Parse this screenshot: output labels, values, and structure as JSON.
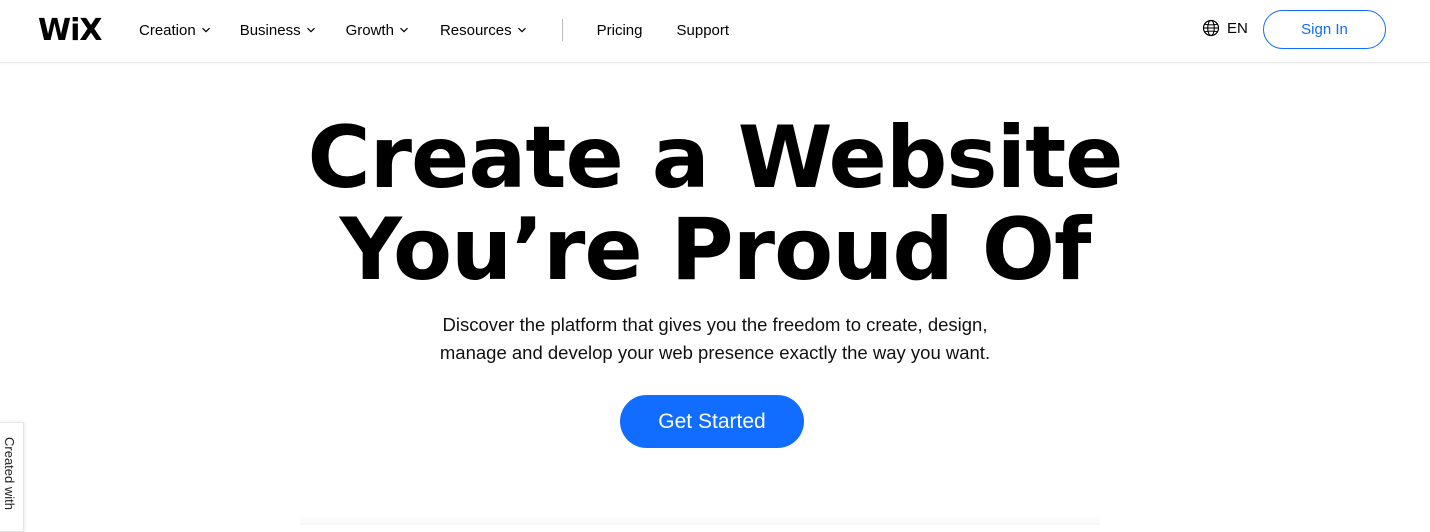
{
  "brand": {
    "logo_text": "WiX"
  },
  "nav": {
    "items": [
      {
        "label": "Creation",
        "has_dropdown": true
      },
      {
        "label": "Business",
        "has_dropdown": true
      },
      {
        "label": "Growth",
        "has_dropdown": true
      },
      {
        "label": "Resources",
        "has_dropdown": true
      }
    ],
    "plain_items": [
      {
        "label": "Pricing"
      },
      {
        "label": "Support"
      }
    ]
  },
  "header_right": {
    "language": "EN",
    "language_icon": "globe-icon",
    "sign_in_label": "Sign In"
  },
  "hero": {
    "title_line1": "Create a Website",
    "title_line2": "You’re Proud Of",
    "subtitle_line1": "Discover the platform that gives you the freedom to create, design,",
    "subtitle_line2": "manage and develop your web presence exactly the way you want.",
    "cta_label": "Get Started"
  },
  "side_badge": {
    "label": "Created with"
  },
  "colors": {
    "accent": "#116dff",
    "text": "#000000",
    "background": "#ffffff"
  }
}
